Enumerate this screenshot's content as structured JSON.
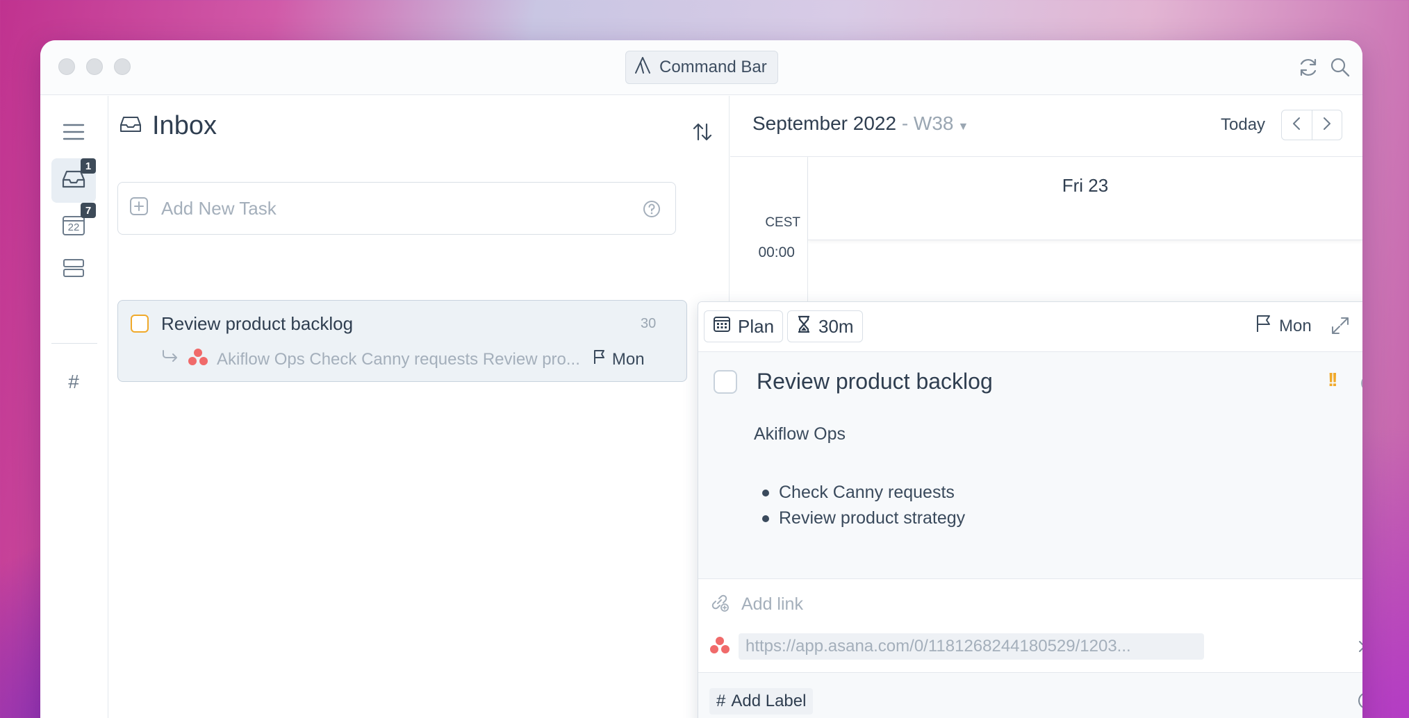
{
  "titlebar": {
    "command_bar": "Command Bar"
  },
  "rail": {
    "inbox_badge": "1",
    "calendar_badge": "7",
    "calendar_day": "22",
    "labels_glyph": "#"
  },
  "inbox": {
    "title": "Inbox",
    "add_task_placeholder": "Add New Task",
    "task": {
      "title": "Review product backlog",
      "time": "30",
      "subtitle": "Akiflow Ops Check Canny requests Review pro...",
      "due": "Mon"
    }
  },
  "calendar": {
    "month": "September 2022",
    "week": " - W38",
    "today_label": "Today",
    "day_header": "Fri  23",
    "timezone": "CEST",
    "first_hour": "00:00"
  },
  "detail": {
    "plan_label": "Plan",
    "duration_label": "30m",
    "due_label": "Mon",
    "title": "Review product backlog",
    "priority": "!!",
    "project": "Akiflow Ops",
    "bullets": [
      "Check Canny requests",
      "Review product strategy"
    ],
    "add_link_placeholder": "Add link",
    "link_url": "https://app.asana.com/0/1181268244180529/1203...",
    "add_label": "Add Label",
    "label_glyph": "#"
  },
  "colors": {
    "accent_orange": "#f0a92a",
    "asana_red": "#f06a6a"
  }
}
